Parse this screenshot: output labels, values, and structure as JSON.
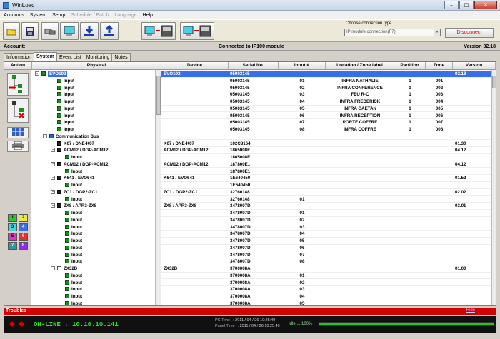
{
  "window": {
    "title": "WinLoad"
  },
  "menu": [
    {
      "label": "Accounts",
      "disabled": false
    },
    {
      "label": "System",
      "disabled": false
    },
    {
      "label": "Setup",
      "disabled": false
    },
    {
      "label": "Schedule / Batch",
      "disabled": true
    },
    {
      "label": "Language",
      "disabled": true
    },
    {
      "label": "Help",
      "disabled": false
    }
  ],
  "toolbar": {
    "icons": [
      "folder-open-icon",
      "save-disk-icon",
      "modem-icon",
      "computer-icon",
      "download-icon",
      "upload-icon",
      "computer-to-panel-icon",
      "panel-to-computer-icon"
    ],
    "connection_label": "Choose connection type",
    "connection_value": "IP module connection(F7)",
    "disconnect_label": "Disconnect"
  },
  "account": {
    "label": "Account:",
    "status": "Connected to IP100 module",
    "version": "Version 02.18"
  },
  "tabs": [
    {
      "label": "Information",
      "active": false
    },
    {
      "label": "System",
      "active": true
    },
    {
      "label": "Event List",
      "active": false
    },
    {
      "label": "Monitoring",
      "active": false
    },
    {
      "label": "Notes",
      "active": false
    }
  ],
  "headers": {
    "action": "Action",
    "physical": "Physical",
    "device": "Device",
    "serial": "Serial No.",
    "input": "Input #",
    "location": "Location / Zone label",
    "partition": "Partition",
    "zone": "Zone",
    "version": "Version"
  },
  "action_numbers": [
    "1",
    "2",
    "3",
    "4",
    "5",
    "6",
    "7",
    "8"
  ],
  "rows": [
    {
      "indent": 0,
      "icon": "g",
      "exp": "-",
      "label": "EVO192",
      "device": "EVO192",
      "serial": "05003145",
      "input": "",
      "location": "",
      "partition": "",
      "zone": "",
      "version": "02.18",
      "selected": true
    },
    {
      "indent": 2,
      "icon": "g",
      "exp": "",
      "label": "Input",
      "device": "",
      "serial": "05003145",
      "input": "01",
      "location": "INFRA NATHALIE",
      "partition": "1",
      "zone": "001",
      "version": ""
    },
    {
      "indent": 2,
      "icon": "g",
      "exp": "",
      "label": "Input",
      "device": "",
      "serial": "05003145",
      "input": "02",
      "location": "INFRA CONFÉRENCE",
      "partition": "1",
      "zone": "002",
      "version": ""
    },
    {
      "indent": 2,
      "icon": "g",
      "exp": "",
      "label": "Input",
      "device": "",
      "serial": "05003145",
      "input": "03",
      "location": "FEU R-C",
      "partition": "1",
      "zone": "003",
      "version": ""
    },
    {
      "indent": 2,
      "icon": "g",
      "exp": "",
      "label": "Input",
      "device": "",
      "serial": "05003145",
      "input": "04",
      "location": "INFRA FREDERICK",
      "partition": "1",
      "zone": "004",
      "version": ""
    },
    {
      "indent": 2,
      "icon": "g",
      "exp": "",
      "label": "Input",
      "device": "",
      "serial": "05003145",
      "input": "05",
      "location": "INFRA GAETAN",
      "partition": "1",
      "zone": "005",
      "version": ""
    },
    {
      "indent": 2,
      "icon": "g",
      "exp": "",
      "label": "Input",
      "device": "",
      "serial": "05003145",
      "input": "06",
      "location": "INFRA RÉCEPTION",
      "partition": "1",
      "zone": "006",
      "version": ""
    },
    {
      "indent": 2,
      "icon": "g",
      "exp": "",
      "label": "Input",
      "device": "",
      "serial": "05003145",
      "input": "07",
      "location": "PORTE COFFRE",
      "partition": "1",
      "zone": "007",
      "version": ""
    },
    {
      "indent": 2,
      "icon": "g",
      "exp": "",
      "label": "Input",
      "device": "",
      "serial": "05003145",
      "input": "08",
      "location": "INFRA COFFRE",
      "partition": "1",
      "zone": "008",
      "version": ""
    },
    {
      "indent": 1,
      "icon": "bus",
      "exp": "-",
      "label": "Communication Bus",
      "device": "",
      "serial": "",
      "input": "",
      "location": "",
      "partition": "",
      "zone": "",
      "version": ""
    },
    {
      "indent": 2,
      "icon": "k",
      "exp": "",
      "label": "K07 / DNE-K07",
      "device": "K07 / DNE-K07",
      "serial": "102C8164",
      "input": "",
      "location": "",
      "partition": "",
      "zone": "",
      "version": "01.30"
    },
    {
      "indent": 2,
      "icon": "k",
      "exp": "-",
      "label": "ACM12 / DGP-ACM12",
      "device": "ACM12 / DGP-ACM12",
      "serial": "1865008E",
      "input": "",
      "location": "",
      "partition": "",
      "zone": "",
      "version": "04.12"
    },
    {
      "indent": 3,
      "icon": "g",
      "exp": "",
      "label": "Input",
      "device": "",
      "serial": "1865008E",
      "input": "",
      "location": "",
      "partition": "",
      "zone": "",
      "version": ""
    },
    {
      "indent": 2,
      "icon": "k",
      "exp": "-",
      "label": "ACM12 / DGP-ACM12",
      "device": "ACM12 / DGP-ACM12",
      "serial": "187800E1",
      "input": "",
      "location": "",
      "partition": "",
      "zone": "",
      "version": "04.12"
    },
    {
      "indent": 3,
      "icon": "g",
      "exp": "",
      "label": "Input",
      "device": "",
      "serial": "187800E1",
      "input": "",
      "location": "",
      "partition": "",
      "zone": "",
      "version": ""
    },
    {
      "indent": 2,
      "icon": "k",
      "exp": "-",
      "label": "K641 / EVO641",
      "device": "K641 / EVO641",
      "serial": "1E640450",
      "input": "",
      "location": "",
      "partition": "",
      "zone": "",
      "version": "01.52"
    },
    {
      "indent": 3,
      "icon": "g",
      "exp": "",
      "label": "Input",
      "device": "",
      "serial": "1E640450",
      "input": "",
      "location": "",
      "partition": "",
      "zone": "",
      "version": ""
    },
    {
      "indent": 2,
      "icon": "k",
      "exp": "-",
      "label": "ZC1 / DGP2-ZC1",
      "device": "ZC1 / DGP2-ZC1",
      "serial": "32760148",
      "input": "",
      "location": "",
      "partition": "",
      "zone": "",
      "version": "02.02"
    },
    {
      "indent": 3,
      "icon": "g",
      "exp": "",
      "label": "Input",
      "device": "",
      "serial": "32760148",
      "input": "01",
      "location": "",
      "partition": "",
      "zone": "",
      "version": ""
    },
    {
      "indent": 2,
      "icon": "k",
      "exp": "-",
      "label": "ZX8 / APR3-ZX8",
      "device": "ZX8 / APR3-ZX8",
      "serial": "3478007D",
      "input": "",
      "location": "",
      "partition": "",
      "zone": "",
      "version": "03.01"
    },
    {
      "indent": 3,
      "icon": "g",
      "exp": "",
      "label": "Input",
      "device": "",
      "serial": "3478007D",
      "input": "01",
      "location": "",
      "partition": "",
      "zone": "",
      "version": ""
    },
    {
      "indent": 3,
      "icon": "g",
      "exp": "",
      "label": "Input",
      "device": "",
      "serial": "3478007D",
      "input": "02",
      "location": "",
      "partition": "",
      "zone": "",
      "version": ""
    },
    {
      "indent": 3,
      "icon": "g",
      "exp": "",
      "label": "Input",
      "device": "",
      "serial": "3478007D",
      "input": "03",
      "location": "",
      "partition": "",
      "zone": "",
      "version": ""
    },
    {
      "indent": 3,
      "icon": "g",
      "exp": "",
      "label": "Input",
      "device": "",
      "serial": "3478007D",
      "input": "04",
      "location": "",
      "partition": "",
      "zone": "",
      "version": ""
    },
    {
      "indent": 3,
      "icon": "g",
      "exp": "",
      "label": "Input",
      "device": "",
      "serial": "3478007D",
      "input": "05",
      "location": "",
      "partition": "",
      "zone": "",
      "version": ""
    },
    {
      "indent": 3,
      "icon": "g",
      "exp": "",
      "label": "Input",
      "device": "",
      "serial": "3478007D",
      "input": "06",
      "location": "",
      "partition": "",
      "zone": "",
      "version": ""
    },
    {
      "indent": 3,
      "icon": "g",
      "exp": "",
      "label": "Input",
      "device": "",
      "serial": "3478007D",
      "input": "07",
      "location": "",
      "partition": "",
      "zone": "",
      "version": ""
    },
    {
      "indent": 3,
      "icon": "g",
      "exp": "",
      "label": "Input",
      "device": "",
      "serial": "3478007D",
      "input": "08",
      "location": "",
      "partition": "",
      "zone": "",
      "version": ""
    },
    {
      "indent": 2,
      "icon": "w",
      "exp": "-",
      "label": "ZX32D",
      "device": "ZX32D",
      "serial": "3700008A",
      "input": "",
      "location": "",
      "partition": "",
      "zone": "",
      "version": "01.00"
    },
    {
      "indent": 3,
      "icon": "g",
      "exp": "",
      "label": "Input",
      "device": "",
      "serial": "3700008A",
      "input": "01",
      "location": "",
      "partition": "",
      "zone": "",
      "version": ""
    },
    {
      "indent": 3,
      "icon": "g",
      "exp": "",
      "label": "Input",
      "device": "",
      "serial": "3700008A",
      "input": "02",
      "location": "",
      "partition": "",
      "zone": "",
      "version": ""
    },
    {
      "indent": 3,
      "icon": "g",
      "exp": "",
      "label": "Input",
      "device": "",
      "serial": "3700008A",
      "input": "03",
      "location": "",
      "partition": "",
      "zone": "",
      "version": ""
    },
    {
      "indent": 3,
      "icon": "g",
      "exp": "",
      "label": "Input",
      "device": "",
      "serial": "3700008A",
      "input": "04",
      "location": "",
      "partition": "",
      "zone": "",
      "version": ""
    },
    {
      "indent": 3,
      "icon": "g",
      "exp": "",
      "label": "Input",
      "device": "",
      "serial": "3700008A",
      "input": "05",
      "location": "",
      "partition": "",
      "zone": "",
      "version": ""
    }
  ],
  "troubles": {
    "label": "Troubles",
    "right": "Hide"
  },
  "status": {
    "online": "ON-LINE : 10.10.10.141",
    "pc_time_label": "PC Time",
    "pc_time": ": 2011 / 04 / 26  10:25:49",
    "panel_time_label": "Panel Time",
    "panel_time": ": 2011 / 04 / 26  10:25:49",
    "idle": "Idle ... 100%",
    "progress": 1.0
  },
  "colors": {
    "selection": "#3a6ee8",
    "troubles": "#d40000",
    "online": "#2ee02e"
  }
}
